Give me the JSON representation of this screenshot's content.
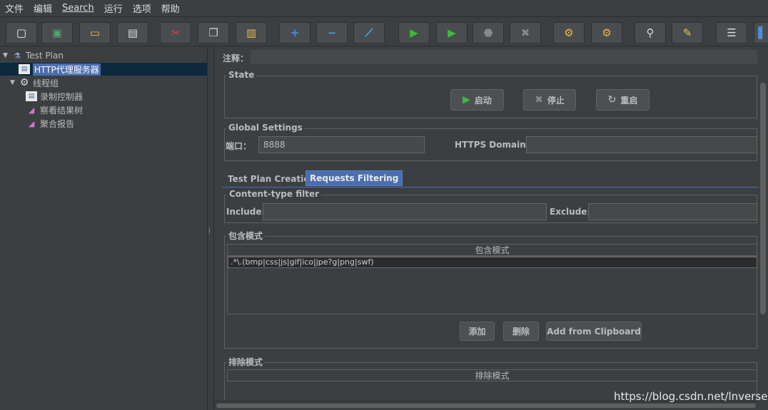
{
  "menu": [
    "文件",
    "编辑",
    "Search",
    "运行",
    "选项",
    "帮助"
  ],
  "toolbar": {
    "icons": [
      {
        "name": "new-icon",
        "glyph": "▢",
        "color": "#f2f2f2"
      },
      {
        "name": "templates-icon",
        "glyph": "▣",
        "color": "#4fa86a"
      },
      {
        "name": "open-icon",
        "glyph": "▭",
        "color": "#e6b84a"
      },
      {
        "name": "save-icon",
        "glyph": "▤",
        "color": "#dcdcdc"
      },
      {
        "name": "cut-icon",
        "glyph": "✂",
        "color": "#e04040"
      },
      {
        "name": "copy-icon",
        "glyph": "❐",
        "color": "#cfcfcf"
      },
      {
        "name": "paste-icon",
        "glyph": "▥",
        "color": "#e6b84a"
      },
      {
        "name": "expand-icon",
        "glyph": "+",
        "color": "#4a8fe0"
      },
      {
        "name": "collapse-icon",
        "glyph": "−",
        "color": "#4a8fe0"
      },
      {
        "name": "toggle-icon",
        "glyph": "⟋",
        "color": "#4ab0e0"
      },
      {
        "name": "start-icon",
        "glyph": "▶",
        "color": "#3cba3c"
      },
      {
        "name": "start-no-pauses-icon",
        "glyph": "▶",
        "color": "#3cba3c"
      },
      {
        "name": "stop-icon",
        "glyph": "⬣",
        "color": "#888888"
      },
      {
        "name": "shutdown-icon",
        "glyph": "✖",
        "color": "#888888"
      },
      {
        "name": "clear-icon",
        "glyph": "⚙",
        "color": "#e6b84a"
      },
      {
        "name": "clear-all-icon",
        "glyph": "⚙",
        "color": "#e6b84a"
      },
      {
        "name": "search-icon",
        "glyph": "⚲",
        "color": "#dcdcdc"
      },
      {
        "name": "reset-search-icon",
        "glyph": "✎",
        "color": "#e6c84a"
      },
      {
        "name": "function-helper-icon",
        "glyph": "☰",
        "color": "#dcdcdc"
      },
      {
        "name": "help-icon",
        "glyph": "▌",
        "color": "#4a8fe0"
      }
    ]
  },
  "tree": {
    "test_plan": "Test Plan",
    "http_proxy": "HTTP代理服务器",
    "thread_group": "线程组",
    "recording_controller": "录制控制器",
    "view_results_tree": "察看结果树",
    "aggregate_report": "聚合报告"
  },
  "right": {
    "comments_label": "注释：",
    "comments_value": "",
    "state_legend": "State",
    "start_label": "启动",
    "stop_label": "停止",
    "restart_label": "重启",
    "global_legend": "Global Settings",
    "port_label": "端口：",
    "port_value": "8888",
    "https_label": "HTTPS Domains:",
    "https_value": "",
    "tab_creation": "Test Plan Creation",
    "tab_filtering": "Requests Filtering",
    "content_type_legend": "Content-type filter",
    "include_label": "Include:",
    "include_value": "",
    "exclude_label": "Exclude:",
    "exclude_value": "",
    "include_patterns_legend": "包含模式",
    "include_patterns_header": "包含模式",
    "include_patterns_row": ".*\\.(bmp|css|js|gif|ico|jpe?g|png|swf)",
    "add_label": "添加",
    "delete_label": "删除",
    "clipboard_label": "Add from Clipboard",
    "exclude_patterns_legend": "排除模式",
    "exclude_patterns_header": "排除模式"
  },
  "watermark": "https://blog.csdn.net/lnversep"
}
